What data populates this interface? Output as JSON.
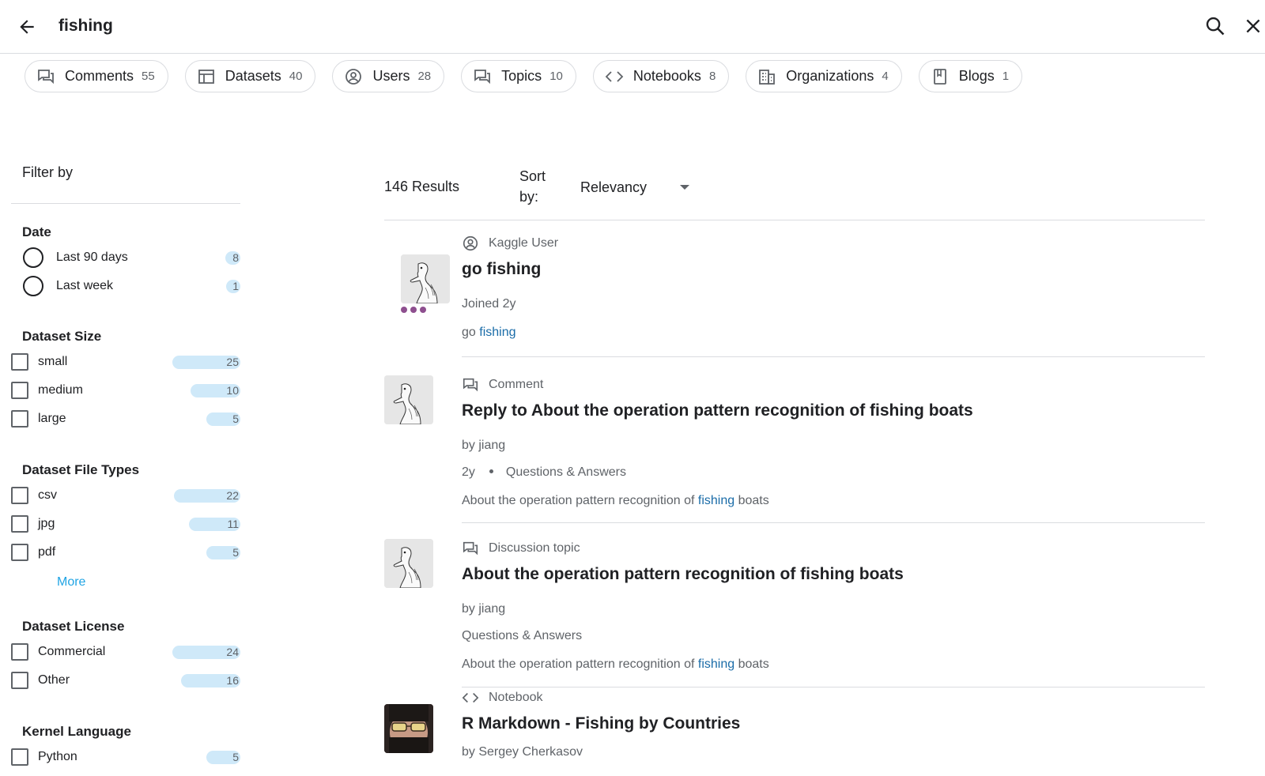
{
  "search": {
    "query": "fishing"
  },
  "chips": [
    {
      "label": "Comments",
      "count": "55",
      "icon": "comments-icon"
    },
    {
      "label": "Datasets",
      "count": "40",
      "icon": "table-icon"
    },
    {
      "label": "Users",
      "count": "28",
      "icon": "user-circle-icon"
    },
    {
      "label": "Topics",
      "count": "10",
      "icon": "comments-icon"
    },
    {
      "label": "Notebooks",
      "count": "8",
      "icon": "code-icon"
    },
    {
      "label": "Organizations",
      "count": "4",
      "icon": "building-icon"
    },
    {
      "label": "Blogs",
      "count": "1",
      "icon": "bookmark-icon"
    }
  ],
  "filter": {
    "title": "Filter by",
    "more_label": "More",
    "groups": [
      {
        "title": "Date",
        "options": [
          {
            "label": "Last 90 days",
            "count": "8",
            "fraction": 0.22
          },
          {
            "label": "Last week",
            "count": "1",
            "fraction": 0.07
          }
        ]
      },
      {
        "title": "Dataset Size",
        "options": [
          {
            "label": "small",
            "count": "25",
            "fraction": 1.0
          },
          {
            "label": "medium",
            "count": "10",
            "fraction": 0.73
          },
          {
            "label": "large",
            "count": "5",
            "fraction": 0.5
          }
        ]
      },
      {
        "title": "Dataset File Types",
        "options": [
          {
            "label": "csv",
            "count": "22",
            "fraction": 0.98
          },
          {
            "label": "jpg",
            "count": "11",
            "fraction": 0.76
          },
          {
            "label": "pdf",
            "count": "5",
            "fraction": 0.5
          }
        ]
      },
      {
        "title": "Dataset License",
        "options": [
          {
            "label": "Commercial",
            "count": "24",
            "fraction": 1.0
          },
          {
            "label": "Other",
            "count": "16",
            "fraction": 0.87
          }
        ]
      },
      {
        "title": "Kernel Language",
        "options": [
          {
            "label": "Python",
            "count": "5",
            "fraction": 0.5
          }
        ]
      }
    ]
  },
  "results_header": {
    "count_text": "146 Results",
    "sort_label": "Sort by:",
    "sort_value": "Relevancy"
  },
  "results": [
    {
      "type": "Kaggle User",
      "title": "go fishing",
      "line1": "Joined 2y",
      "snippet_pre": "go ",
      "snippet_hl": "fishing",
      "snippet_post": ""
    },
    {
      "type": "Comment",
      "title": "Reply to About the operation pattern recognition of fishing boats",
      "line1": "by jiang",
      "line2_a": "2y",
      "line2_b": "Questions & Answers",
      "snippet_pre": "About the operation pattern recognition of ",
      "snippet_hl": "fishing",
      "snippet_post": " boats"
    },
    {
      "type": "Discussion topic",
      "title": "About the operation pattern recognition of fishing boats",
      "line1": "by jiang",
      "line2": "Questions & Answers",
      "snippet_pre": "About the operation pattern recognition of ",
      "snippet_hl": "fishing",
      "snippet_post": " boats"
    },
    {
      "type": "Notebook",
      "title": "R Markdown - Fishing by Countries",
      "line1": "by Sergey Cherkasov"
    }
  ],
  "colors": {
    "accent_link": "#20a4e4",
    "highlight": "#1a6ca8",
    "count_bar": "#cfe9f9",
    "tier": "#8e4f8f"
  }
}
